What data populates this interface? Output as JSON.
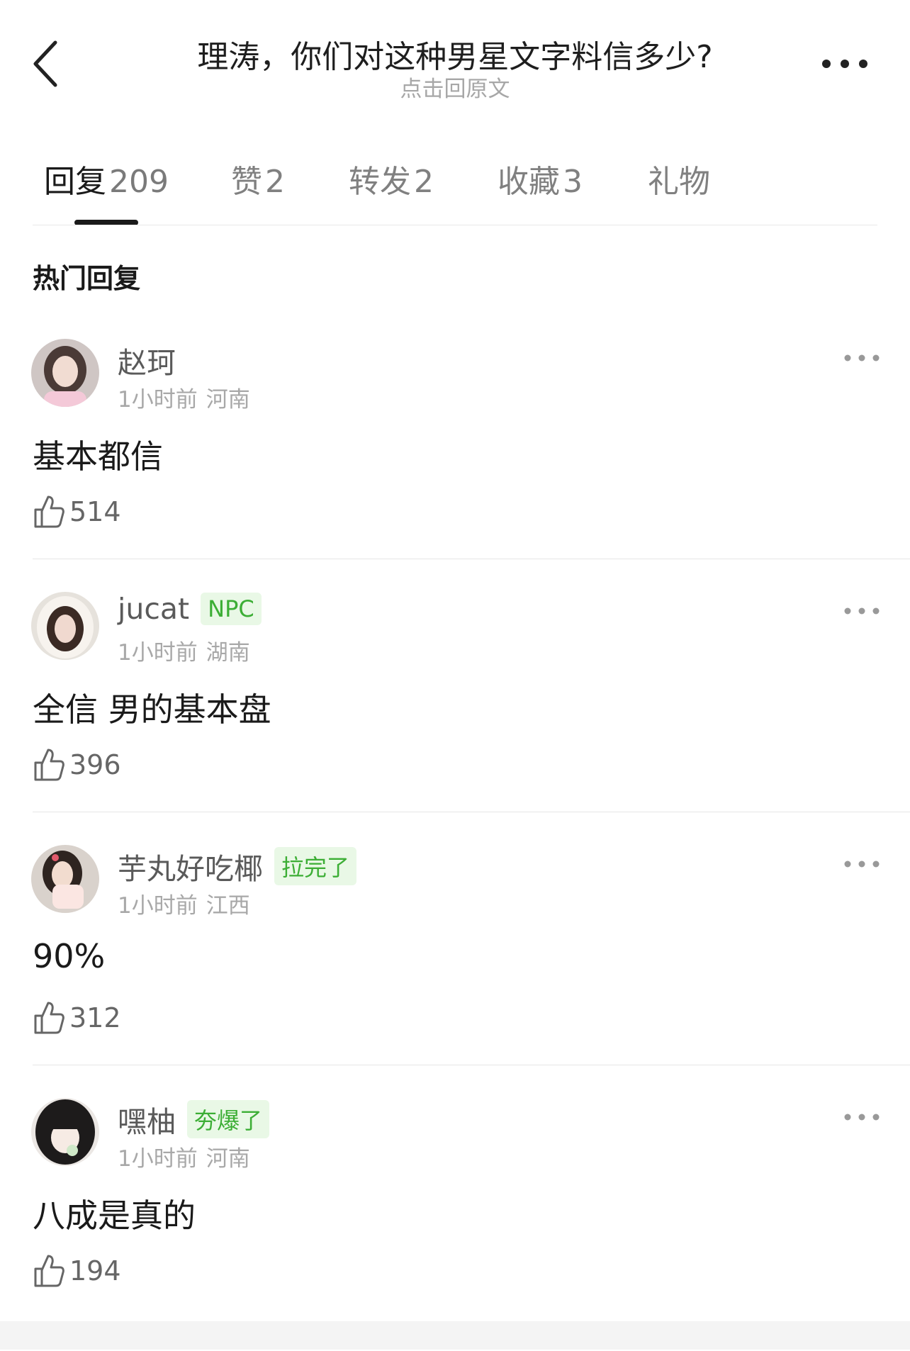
{
  "header": {
    "title": "理涛，你们对这种男星文字料信多少?",
    "subtitle": "点击回原文"
  },
  "tabs": [
    {
      "label": "回复",
      "count": "209",
      "active": true
    },
    {
      "label": "赞",
      "count": "2"
    },
    {
      "label": "转发",
      "count": "2"
    },
    {
      "label": "收藏",
      "count": "3"
    },
    {
      "label": "礼物",
      "count": ""
    }
  ],
  "section_title": "热门回复",
  "comments": [
    {
      "username": "赵珂",
      "badge": "",
      "time": "1小时前",
      "location": "河南",
      "text": "基本都信",
      "likes": "514"
    },
    {
      "username": "jucat",
      "badge": "NPC",
      "time": "1小时前",
      "location": "湖南",
      "text": "全信 男的基本盘",
      "likes": "396"
    },
    {
      "username": "芋丸好吃椰",
      "badge": "拉完了",
      "time": "1小时前",
      "location": "江西",
      "text": "90%",
      "likes": "312"
    },
    {
      "username": "嘿柚",
      "badge": "夯爆了",
      "time": "1小时前",
      "location": "河南",
      "text": "八成是真的",
      "likes": "194"
    }
  ],
  "colors": {
    "badge_text": "#3cae35",
    "badge_bg": "#e9f8e6",
    "active_tab": "#1a1a1a"
  }
}
